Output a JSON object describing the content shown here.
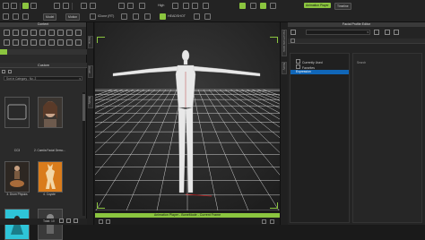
{
  "toolbar": {
    "mode_label": "Model",
    "mode2_label": "Motion",
    "quality_label": "High",
    "headshot_label": "HEADSHOT",
    "iclone_label": "iClone (RT)",
    "animation_player_label": "Animation Player",
    "timeline_label": "Timeline"
  },
  "content": {
    "title": "Content",
    "custom_tab": "Custom",
    "sort_label": "Sort in Category : No. 2",
    "items": [
      {
        "label": "CC3"
      },
      {
        "label": "2. Camila Facial Demo..."
      },
      {
        "label": "3. Drum Physics"
      },
      {
        "label": "4. Coyote"
      },
      {
        "label": ""
      },
      {
        "label": ""
      }
    ],
    "footer_total": "Total: 10",
    "side_tabs": [
      "Scene",
      "Visual",
      "Modify"
    ]
  },
  "viewport": {
    "playbar_label": "Animation Player - BoneMode - Current Frame"
  },
  "facial_editor": {
    "title": "Facial Profile Editor",
    "side_tab": "Facial Profile Editor",
    "side_tab2": "Modify",
    "dropdown_value": "",
    "tree": [
      "Currently Used",
      "Favorites",
      "Expression"
    ],
    "right_column_header": "Search"
  },
  "colors": {
    "accent": "#8bc53f",
    "panel": "#2a2a2a",
    "dark": "#1a1a1a"
  }
}
